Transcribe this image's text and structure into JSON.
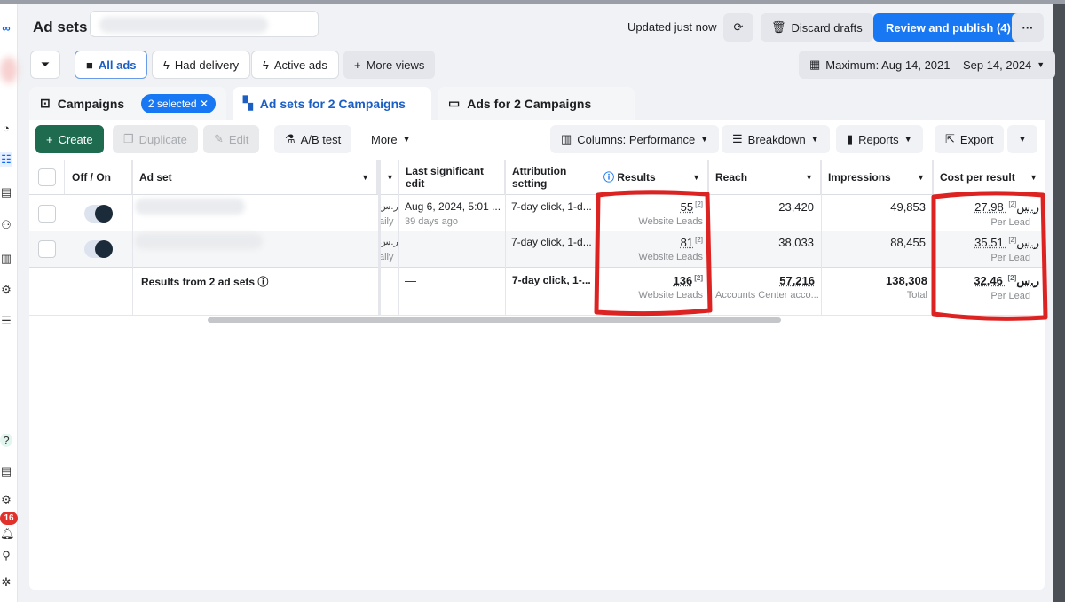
{
  "header": {
    "title": "Ad sets",
    "updated": "Updated just now",
    "discard": "Discard drafts",
    "publish": "Review and publish (4)",
    "more": "···",
    "date_range": "Maximum: Aug 14, 2021 – Sep 14, 2024"
  },
  "views": {
    "all": "All ads",
    "had_delivery": "Had delivery",
    "active": "Active ads",
    "more_views": "More views"
  },
  "tabs": {
    "campaigns": "Campaigns",
    "selected": "2 selected",
    "adsets": "Ad sets for 2 Campaigns",
    "ads": "Ads for 2 Campaigns"
  },
  "toolbar": {
    "create": "Create",
    "duplicate": "Duplicate",
    "edit": "Edit",
    "ab": "A/B test",
    "more": "More",
    "columns": "Columns: Performance",
    "breakdown": "Breakdown",
    "reports": "Reports",
    "export": "Export"
  },
  "sidebar": {
    "badge": "16"
  },
  "table": {
    "headers": {
      "toggle": "Off / On",
      "adset": "Ad set",
      "last_edit": "Last significant edit",
      "attribution": "Attribution setting",
      "results": "Results",
      "reach": "Reach",
      "impressions": "Impressions",
      "cpr": "Cost per result"
    },
    "rows": [
      {
        "budget_cur": "ر.س",
        "budget_type": "aily",
        "last_edit": "Aug 6, 2024, 5:01 ...",
        "last_edit_sub": "39 days ago",
        "attribution": "7-day click, 1-d...",
        "results": "55",
        "results_sup": "[2]",
        "results_sub": "Website Leads",
        "reach": "23,420",
        "impressions": "49,853",
        "cpr": "27.98 ر.س",
        "cpr_sup": "[2]",
        "cpr_sub": "Per Lead"
      },
      {
        "budget_cur": "ر.س",
        "budget_type": "aily",
        "attribution": "7-day click, 1-d...",
        "results": "81",
        "results_sup": "[2]",
        "results_sub": "Website Leads",
        "reach": "38,033",
        "impressions": "88,455",
        "cpr": "35.51 ر.س",
        "cpr_sup": "[2]",
        "cpr_sub": "Per Lead"
      }
    ],
    "summary": {
      "label": "Results from 2 ad sets",
      "last_edit": "—",
      "attribution": "7-day click, 1-...",
      "results": "136",
      "results_sup": "[2]",
      "results_sub": "Website Leads",
      "reach": "57,216",
      "reach_sub": "Accounts Center acco...",
      "impressions": "138,308",
      "impressions_sub": "Total",
      "cpr": "32.46 ر.س",
      "cpr_sup": "[2]",
      "cpr_sub": "Per Lead"
    }
  }
}
